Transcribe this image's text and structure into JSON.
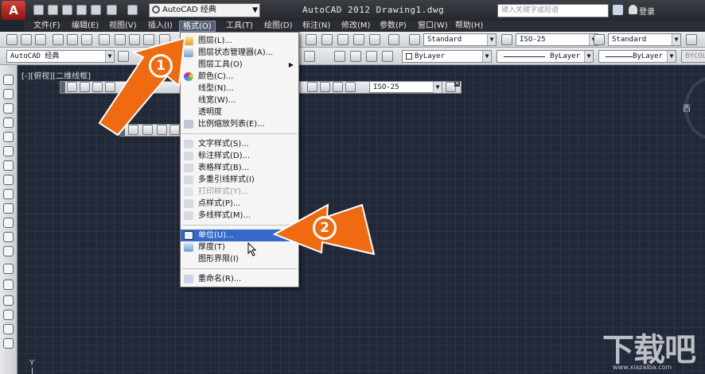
{
  "titlebar": {
    "logo_letter": "A",
    "workspace": "AutoCAD 经典",
    "title": "AutoCAD 2012    Drawing1.dwg",
    "search_placeholder": "键入关键字或短语",
    "login": "登录"
  },
  "menubar": {
    "items": [
      "文件(F)",
      "编辑(E)",
      "视图(V)",
      "插入(I)",
      "格式(O)",
      "工具(T)",
      "绘图(D)",
      "标注(N)",
      "修改(M)",
      "参数(P)",
      "窗口(W)",
      "帮助(H)"
    ],
    "active_index": 4
  },
  "toolbar1": {
    "text_style": "Standard",
    "dim_style": "ISO-25",
    "table_style": "Standard"
  },
  "toolbar2": {
    "workspace": "AutoCAD 经典",
    "layer_color": "ByLayer",
    "linetype": "ByLayer",
    "lineweight": "ByLayer",
    "plotstyle": "BYCOLOR"
  },
  "canvas": {
    "view_label": "[-][俯视][二维线框]",
    "viewcube_label": "西",
    "ucs_y_label": "Y"
  },
  "float_toolbar": {
    "dim_style": "ISO-25"
  },
  "format_menu": {
    "items": [
      {
        "label": "图层(L)...",
        "icon": "layer-icon",
        "enabled": true
      },
      {
        "label": "图层状态管理器(A)...",
        "icon": "layer-state-icon",
        "enabled": true
      },
      {
        "label": "图层工具(O)",
        "icon": "",
        "enabled": true,
        "submenu": true
      },
      {
        "label": "颜色(C)...",
        "icon": "color-wheel-icon",
        "enabled": true
      },
      {
        "label": "线型(N)...",
        "icon": "",
        "enabled": true
      },
      {
        "label": "线宽(W)...",
        "icon": "",
        "enabled": true
      },
      {
        "label": "透明度",
        "icon": "",
        "enabled": true
      },
      {
        "label": "比例缩放列表(E)...",
        "icon": "scale-list-icon",
        "enabled": true
      },
      {
        "label": "文字样式(S)...",
        "icon": "text-style-icon",
        "enabled": true
      },
      {
        "label": "标注样式(D)...",
        "icon": "dim-style-icon",
        "enabled": true
      },
      {
        "label": "表格样式(B)...",
        "icon": "table-style-icon",
        "enabled": true
      },
      {
        "label": "多重引线样式(I)",
        "icon": "mleader-style-icon",
        "enabled": true
      },
      {
        "label": "打印样式(Y)...",
        "icon": "plot-style-icon",
        "enabled": false
      },
      {
        "label": "点样式(P)...",
        "icon": "point-style-icon",
        "enabled": true
      },
      {
        "label": "多线样式(M)...",
        "icon": "mline-style-icon",
        "enabled": true
      },
      {
        "label": "单位(U)...",
        "icon": "units-icon",
        "enabled": true,
        "highlighted": true
      },
      {
        "label": "厚度(T)",
        "icon": "thickness-icon",
        "enabled": true
      },
      {
        "label": "图形界限(I)",
        "icon": "",
        "enabled": true
      },
      {
        "label": "重命名(R)...",
        "icon": "rename-icon",
        "enabled": true
      }
    ]
  },
  "callouts": {
    "one": "1",
    "two": "2"
  },
  "watermark": {
    "text": "下载吧",
    "url": "www.xiazaiba.com"
  },
  "colors": {
    "accent_orange": "#f06a12",
    "menu_highlight": "#3468c9",
    "canvas_bg": "#212837"
  }
}
